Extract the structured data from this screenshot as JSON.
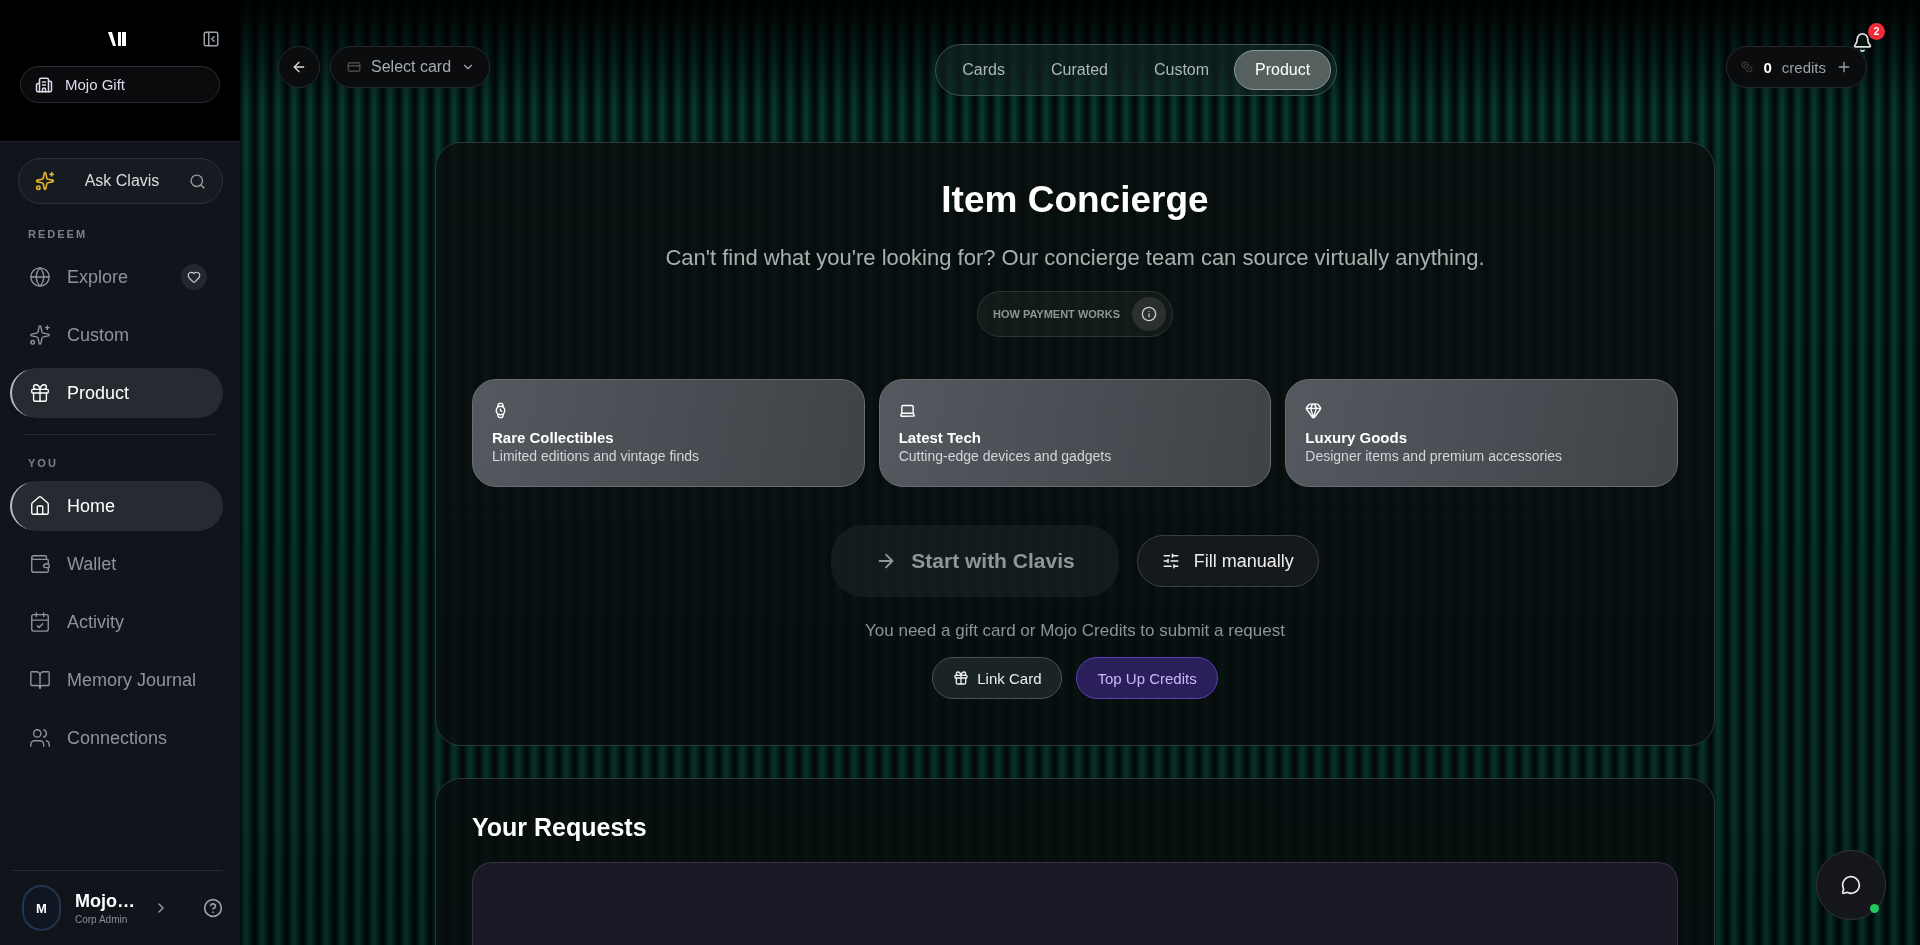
{
  "sidebar": {
    "workspace": "Mojo Gift",
    "assistant": "Ask Clavis",
    "sections": [
      {
        "heading": "REDEEM",
        "items": [
          {
            "label": "Explore",
            "selected": false
          },
          {
            "label": "Custom",
            "selected": false
          },
          {
            "label": "Product",
            "selected": true
          }
        ]
      },
      {
        "heading": "YOU",
        "items": [
          {
            "label": "Home",
            "selected": true
          },
          {
            "label": "Wallet",
            "selected": false
          },
          {
            "label": "Activity",
            "selected": false
          },
          {
            "label": "Memory Journal",
            "selected": false
          },
          {
            "label": "Connections",
            "selected": false
          }
        ]
      }
    ],
    "user": {
      "initial": "M",
      "name": "Mojo…",
      "role": "Corp Admin"
    }
  },
  "topbar": {
    "card_select": "Select card",
    "tabs": [
      {
        "label": "Cards",
        "selected": false
      },
      {
        "label": "Curated",
        "selected": false
      },
      {
        "label": "Custom",
        "selected": false
      },
      {
        "label": "Product",
        "selected": true
      }
    ],
    "credits": {
      "amount": "0",
      "label": "credits"
    },
    "notifications": "2"
  },
  "concierge": {
    "title": "Item Concierge",
    "subtitle": "Can't find what you're looking for? Our concierge team can source virtually anything.",
    "payment_info": "HOW PAYMENT WORKS",
    "categories": [
      {
        "title": "Rare Collectibles",
        "description": "Limited editions and vintage finds"
      },
      {
        "title": "Latest Tech",
        "description": "Cutting-edge devices and gadgets"
      },
      {
        "title": "Luxury Goods",
        "description": "Designer items and premium accessories"
      }
    ],
    "actions": [
      {
        "label": "Start with Clavis",
        "kind": "clavis",
        "disabled": true
      },
      {
        "label": "Fill manually",
        "kind": "manual",
        "disabled": false
      }
    ],
    "note": "You need a gift card or Mojo Credits to submit a request",
    "links": [
      {
        "label": "Link Card",
        "kind": "link"
      },
      {
        "label": "Top Up Credits",
        "kind": "topup"
      }
    ]
  },
  "requests": {
    "title": "Your Requests"
  }
}
